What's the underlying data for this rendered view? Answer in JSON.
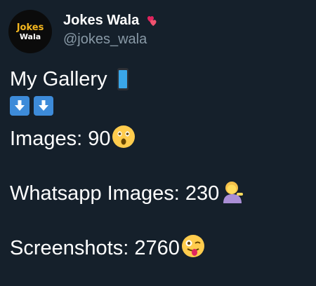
{
  "author": {
    "avatar_line1": "Jokes",
    "avatar_line2": "Wala",
    "display_name": "Jokes Wala",
    "handle": "@jokes_wala"
  },
  "tweet": {
    "title": "My Gallery",
    "images_label": "Images: 90",
    "whatsapp_label": "Whatsapp Images: 230",
    "screenshots_label": "Screenshots: 2760"
  },
  "icons": {
    "name_badge": "two-hearts-icon",
    "title_emoji": "mobile-phone-icon",
    "arrows": [
      "down-arrow-icon",
      "down-arrow-icon"
    ],
    "images_emoji": "astonished-face-icon",
    "whatsapp_emoji": "person-tipping-hand-icon",
    "screenshots_emoji": "winking-face-with-tongue-icon"
  },
  "colors": {
    "background": "#15202b",
    "text": "#ffffff",
    "secondary_text": "#8899a6",
    "arrow_box": "#3d8bd9"
  }
}
